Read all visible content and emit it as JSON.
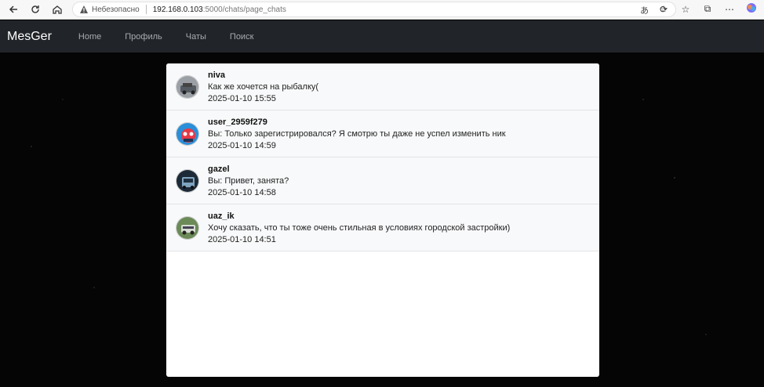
{
  "browser": {
    "insecure_label": "Небезопасно",
    "url_host": "192.168.0.103",
    "url_path": ":5000/chats/page_chats"
  },
  "navbar": {
    "brand": "MesGer",
    "links": [
      "Home",
      "Профиль",
      "Чаты",
      "Поиск"
    ]
  },
  "chats": [
    {
      "name": "niva",
      "message": "Как же хочется на рыбалку(",
      "time": "2025-01-10 15:55",
      "avatar_color": "#8a8f96"
    },
    {
      "name": "user_2959f279",
      "message": "Вы: Только зарегистрировался? Я смотрю ты даже не успел изменить ник",
      "time": "2025-01-10 14:59",
      "avatar_color": "#2a8fd8"
    },
    {
      "name": "gazel",
      "message": "Вы: Привет, занята?",
      "time": "2025-01-10 14:58",
      "avatar_color": "#1c2a38"
    },
    {
      "name": "uaz_ik",
      "message": "Хочу сказать, что ты тоже очень стильная в условиях городской застройки)",
      "time": "2025-01-10 14:51",
      "avatar_color": "#5d7a4a"
    }
  ]
}
